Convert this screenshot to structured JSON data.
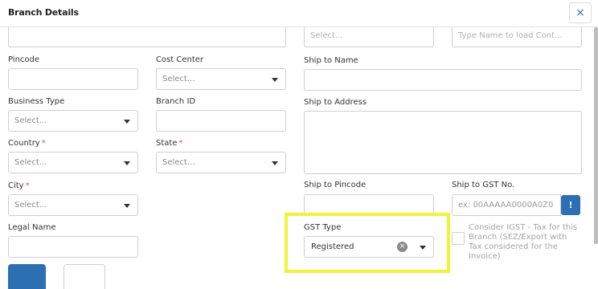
{
  "header": {
    "title": "Branch Details",
    "close_glyph": "×"
  },
  "top_row": {
    "select_placeholder": "Select...",
    "contact_placeholder": "Type Name to load Cont..."
  },
  "fields": {
    "pincode": {
      "label": "Pincode"
    },
    "cost_center": {
      "label": "Cost Center",
      "placeholder": "Select..."
    },
    "ship_to_name": {
      "label": "Ship to Name"
    },
    "business_type": {
      "label": "Business Type",
      "placeholder": "Select..."
    },
    "branch_id": {
      "label": "Branch ID"
    },
    "ship_to_address": {
      "label": "Ship to Address"
    },
    "country": {
      "label": "Country",
      "required_mark": "*",
      "placeholder": "Select..."
    },
    "state": {
      "label": "State",
      "required_mark": "*",
      "placeholder": "Select..."
    },
    "city": {
      "label": "City",
      "required_mark": "*",
      "placeholder": "Select..."
    },
    "ship_to_pincode": {
      "label": "Ship to Pincode"
    },
    "ship_to_gst": {
      "label": "Ship to GST No.",
      "placeholder": "ex: 00AAAAA0000A0Z0"
    },
    "legal_name": {
      "label": "Legal Name"
    },
    "gst_type": {
      "label": "GST Type",
      "value": "Registered"
    },
    "igst": {
      "label": "Consider IGST - Tax for this Branch (SEZ/Export with Tax considered for the Invoice)"
    }
  },
  "icons": {
    "info": "info-icon",
    "clear": "clear-icon",
    "caret": "chevron-down-icon",
    "close": "close-icon"
  },
  "colors": {
    "accent": "#2d6fb3",
    "highlight": "#f1f23a",
    "required": "#d9534f"
  }
}
